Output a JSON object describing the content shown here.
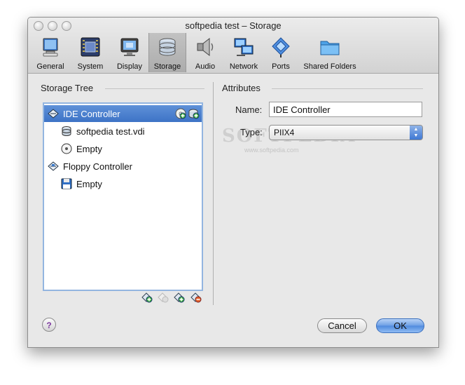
{
  "window": {
    "title": "softpedia test – Storage"
  },
  "toolbar": {
    "items": [
      {
        "label": "General",
        "icon": "monitor-icon"
      },
      {
        "label": "System",
        "icon": "chip-icon"
      },
      {
        "label": "Display",
        "icon": "display-icon"
      },
      {
        "label": "Storage",
        "icon": "storage-icon",
        "selected": true
      },
      {
        "label": "Audio",
        "icon": "speaker-icon"
      },
      {
        "label": "Network",
        "icon": "network-icon"
      },
      {
        "label": "Ports",
        "icon": "port-icon"
      },
      {
        "label": "Shared Folders",
        "icon": "folder-icon"
      }
    ]
  },
  "storage_tree": {
    "title": "Storage Tree",
    "items": [
      {
        "label": "IDE Controller",
        "type": "controller",
        "selected": true
      },
      {
        "label": "softpedia test.vdi",
        "type": "hard-disk"
      },
      {
        "label": "Empty",
        "type": "cd-dvd"
      },
      {
        "label": "Floppy Controller",
        "type": "controller"
      },
      {
        "label": "Empty",
        "type": "floppy"
      }
    ]
  },
  "attributes": {
    "title": "Attributes",
    "name_label": "Name:",
    "name_value": "IDE Controller",
    "type_label": "Type:",
    "type_value": "PIIX4"
  },
  "watermark": {
    "text": "SOFTPEDIA",
    "sub": "www.softpedia.com"
  },
  "buttons": {
    "help": "?",
    "cancel": "Cancel",
    "ok": "OK"
  },
  "colors": {
    "selection": "#3d73c6",
    "default_button": "#4f8ade",
    "tree_border": "#93b5e0"
  }
}
